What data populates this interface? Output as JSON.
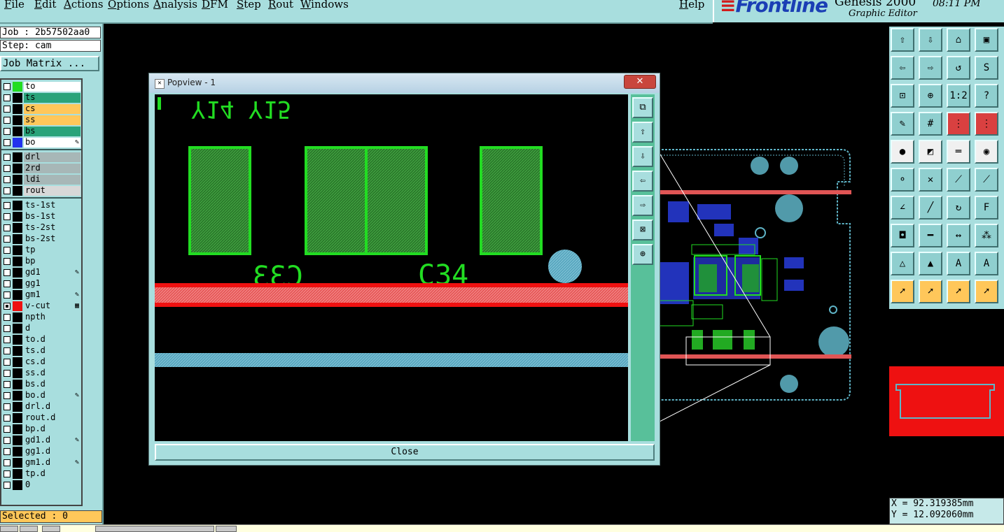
{
  "menu": {
    "items": [
      "File",
      "Edit",
      "Actions",
      "Options",
      "Analysis",
      "DFM",
      "Step",
      "Rout",
      "Windows"
    ],
    "help": "Help"
  },
  "brand": {
    "logo": "Frontline",
    "product": "Genesis 2000",
    "subtitle": "Graphic Editor",
    "time": "08:11 PM"
  },
  "job": {
    "job_line": "Job : 2b57502aa0",
    "step_line": "Step: cam",
    "matrix_button": "Job Matrix ..."
  },
  "layers": [
    {
      "name": "to",
      "swatch": "#22dd22",
      "bg": "#ffffff",
      "checked": false,
      "edit": ""
    },
    {
      "name": "ts",
      "swatch": "#000000",
      "bg": "#2aa37a",
      "checked": false,
      "edit": ""
    },
    {
      "name": "cs",
      "swatch": "#000000",
      "bg": "#ffc75a",
      "checked": false,
      "edit": ""
    },
    {
      "name": "ss",
      "swatch": "#000000",
      "bg": "#ffc75a",
      "checked": false,
      "edit": ""
    },
    {
      "name": "bs",
      "swatch": "#000000",
      "bg": "#2aa37a",
      "checked": false,
      "edit": ""
    },
    {
      "name": "bo",
      "swatch": "#2233ee",
      "bg": "#ffffff",
      "checked": false,
      "edit": "✎"
    },
    {
      "name": "drl",
      "swatch": "#000000",
      "bg": "#a7b7b7",
      "checked": false,
      "edit": ""
    },
    {
      "name": "2rd",
      "swatch": "#000000",
      "bg": "#a7b7b7",
      "checked": false,
      "edit": ""
    },
    {
      "name": "ldi",
      "swatch": "#000000",
      "bg": "#a7b7b7",
      "checked": false,
      "edit": ""
    },
    {
      "name": "rout",
      "swatch": "#000000",
      "bg": "#d8d8d8",
      "checked": false,
      "edit": ""
    },
    {
      "name": "ts-1st",
      "swatch": "#000000",
      "bg": "#a8dede",
      "checked": false,
      "edit": ""
    },
    {
      "name": "bs-1st",
      "swatch": "#000000",
      "bg": "#a8dede",
      "checked": false,
      "edit": ""
    },
    {
      "name": "ts-2st",
      "swatch": "#000000",
      "bg": "#a8dede",
      "checked": false,
      "edit": ""
    },
    {
      "name": "bs-2st",
      "swatch": "#000000",
      "bg": "#a8dede",
      "checked": false,
      "edit": ""
    },
    {
      "name": "tp",
      "swatch": "#000000",
      "bg": "#a8dede",
      "checked": false,
      "edit": ""
    },
    {
      "name": "bp",
      "swatch": "#000000",
      "bg": "#a8dede",
      "checked": false,
      "edit": ""
    },
    {
      "name": "gd1",
      "swatch": "#000000",
      "bg": "#a8dede",
      "checked": false,
      "edit": "✎"
    },
    {
      "name": "gg1",
      "swatch": "#000000",
      "bg": "#a8dede",
      "checked": false,
      "edit": ""
    },
    {
      "name": "gm1",
      "swatch": "#000000",
      "bg": "#a8dede",
      "checked": false,
      "edit": "✎"
    },
    {
      "name": "v-cut",
      "swatch": "#ee1111",
      "bg": "#a8dede",
      "checked": true,
      "edit": "▦"
    },
    {
      "name": "npth",
      "swatch": "#000000",
      "bg": "#a8dede",
      "checked": false,
      "edit": ""
    },
    {
      "name": "d",
      "swatch": "#000000",
      "bg": "#a8dede",
      "checked": false,
      "edit": ""
    },
    {
      "name": "to.d",
      "swatch": "#000000",
      "bg": "#a8dede",
      "checked": false,
      "edit": ""
    },
    {
      "name": "ts.d",
      "swatch": "#000000",
      "bg": "#a8dede",
      "checked": false,
      "edit": ""
    },
    {
      "name": "cs.d",
      "swatch": "#000000",
      "bg": "#a8dede",
      "checked": false,
      "edit": ""
    },
    {
      "name": "ss.d",
      "swatch": "#000000",
      "bg": "#a8dede",
      "checked": false,
      "edit": ""
    },
    {
      "name": "bs.d",
      "swatch": "#000000",
      "bg": "#a8dede",
      "checked": false,
      "edit": ""
    },
    {
      "name": "bo.d",
      "swatch": "#000000",
      "bg": "#a8dede",
      "checked": false,
      "edit": "✎"
    },
    {
      "name": "drl.d",
      "swatch": "#000000",
      "bg": "#a8dede",
      "checked": false,
      "edit": ""
    },
    {
      "name": "rout.d",
      "swatch": "#000000",
      "bg": "#a8dede",
      "checked": false,
      "edit": ""
    },
    {
      "name": "bp.d",
      "swatch": "#000000",
      "bg": "#a8dede",
      "checked": false,
      "edit": ""
    },
    {
      "name": "gd1.d",
      "swatch": "#000000",
      "bg": "#a8dede",
      "checked": false,
      "edit": "✎"
    },
    {
      "name": "gg1.d",
      "swatch": "#000000",
      "bg": "#a8dede",
      "checked": false,
      "edit": ""
    },
    {
      "name": "gm1.d",
      "swatch": "#000000",
      "bg": "#a8dede",
      "checked": false,
      "edit": "✎"
    },
    {
      "name": "tp.d",
      "swatch": "#000000",
      "bg": "#a8dede",
      "checked": false,
      "edit": ""
    },
    {
      "name": "0",
      "swatch": "#000000",
      "bg": "#a8dede",
      "checked": false,
      "edit": ""
    }
  ],
  "selected_text": "Selected : 0",
  "popview": {
    "title": "Popview - 1",
    "close_label": "Close",
    "labels": {
      "c33": "C33",
      "c34": "C34",
      "top": "Y14 Y15"
    },
    "side_tools": [
      "zoom-window-icon",
      "arrow-up-icon",
      "arrow-down-icon",
      "arrow-left-icon",
      "arrow-right-icon",
      "fit-icon",
      "center-icon"
    ]
  },
  "toolbar": {
    "tools": [
      {
        "name": "move-up-icon",
        "glyph": "⇧",
        "style": ""
      },
      {
        "name": "move-down-icon",
        "glyph": "⇩",
        "style": ""
      },
      {
        "name": "home-icon",
        "glyph": "⌂",
        "style": ""
      },
      {
        "name": "window-icon",
        "glyph": "▣",
        "style": ""
      },
      {
        "name": "move-left-icon",
        "glyph": "⇦",
        "style": ""
      },
      {
        "name": "move-right-icon",
        "glyph": "⇨",
        "style": ""
      },
      {
        "name": "redraw-icon",
        "glyph": "↺",
        "style": ""
      },
      {
        "name": "s-curve-icon",
        "glyph": "S",
        "style": ""
      },
      {
        "name": "zoom-fit-icon",
        "glyph": "⊡",
        "style": ""
      },
      {
        "name": "zoom-center-icon",
        "glyph": "⊕",
        "style": ""
      },
      {
        "name": "scale-one-to-two-icon",
        "glyph": "1:2",
        "style": ""
      },
      {
        "name": "help-icon",
        "glyph": "?",
        "style": ""
      },
      {
        "name": "pen-icon",
        "glyph": "✎",
        "style": ""
      },
      {
        "name": "grid-icon",
        "glyph": "#",
        "style": ""
      },
      {
        "name": "layer-red-icon",
        "glyph": "⋮",
        "style": "hot"
      },
      {
        "name": "net-red-icon",
        "glyph": "⋮",
        "style": "hot"
      },
      {
        "name": "pad-select-icon",
        "glyph": "●",
        "style": "wht"
      },
      {
        "name": "feature-select-icon",
        "glyph": "◩",
        "style": "wht"
      },
      {
        "name": "ruler-icon",
        "glyph": "═",
        "style": "wht"
      },
      {
        "name": "circle-select-icon",
        "glyph": "◉",
        "style": "wht"
      },
      {
        "name": "connect-icon",
        "glyph": "⚬",
        "style": ""
      },
      {
        "name": "cross-icon",
        "glyph": "✕",
        "style": ""
      },
      {
        "name": "line-red-icon",
        "glyph": "⟋",
        "style": ""
      },
      {
        "name": "line-blue-icon",
        "glyph": "⟋",
        "style": ""
      },
      {
        "name": "angle-icon",
        "glyph": "∠",
        "style": ""
      },
      {
        "name": "slash-icon",
        "glyph": "╱",
        "style": ""
      },
      {
        "name": "rotate-icon",
        "glyph": "↻",
        "style": ""
      },
      {
        "name": "flip-icon",
        "glyph": "F",
        "style": ""
      },
      {
        "name": "pad-add-icon",
        "glyph": "◘",
        "style": ""
      },
      {
        "name": "line-add-icon",
        "glyph": "━",
        "style": ""
      },
      {
        "name": "dimension-icon",
        "glyph": "↔",
        "style": ""
      },
      {
        "name": "cluster-icon",
        "glyph": "⁂",
        "style": ""
      },
      {
        "name": "triangle-icon",
        "glyph": "△",
        "style": ""
      },
      {
        "name": "triangle-red-icon",
        "glyph": "▲",
        "style": ""
      },
      {
        "name": "triangle-a-icon",
        "glyph": "A",
        "style": ""
      },
      {
        "name": "triangle-b-icon",
        "glyph": "A",
        "style": ""
      },
      {
        "name": "pointer-icon",
        "glyph": "➚",
        "style": "sel"
      },
      {
        "name": "pointer-red-icon",
        "glyph": "➚",
        "style": "sel"
      },
      {
        "name": "pointer-box-icon",
        "glyph": "➚",
        "style": "sel"
      },
      {
        "name": "pointer-net-icon",
        "glyph": "➚",
        "style": "sel"
      }
    ]
  },
  "coords": {
    "x": "X = 92.319385mm",
    "y": "Y = 12.092060mm"
  }
}
